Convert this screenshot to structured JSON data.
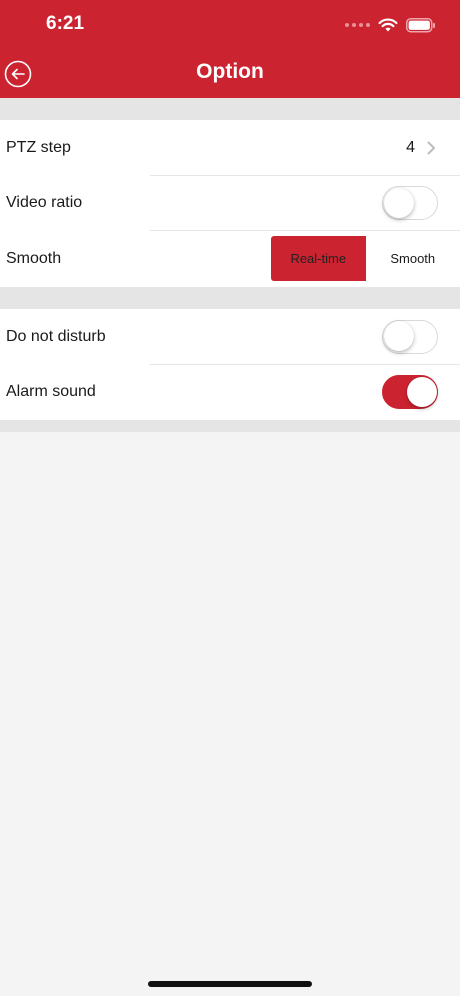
{
  "status_bar": {
    "time": "6:21"
  },
  "nav": {
    "title": "Option"
  },
  "settings": {
    "ptz_step": {
      "label": "PTZ step",
      "value": "4"
    },
    "video_ratio": {
      "label": "Video ratio",
      "enabled": false
    },
    "smooth": {
      "label": "Smooth",
      "options": [
        "Real-time",
        "Smooth"
      ],
      "selected": "Real-time"
    },
    "do_not_disturb": {
      "label": "Do not disturb",
      "enabled": false
    },
    "alarm_sound": {
      "label": "Alarm sound",
      "enabled": true
    }
  },
  "colors": {
    "accent": "#cc2331",
    "background": "#f4f4f4",
    "section_gap": "#e5e5e5"
  }
}
